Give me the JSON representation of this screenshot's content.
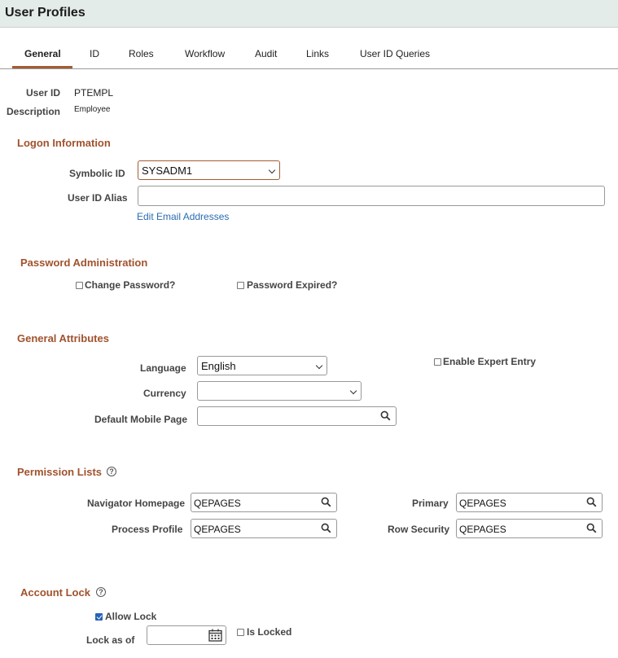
{
  "header": {
    "title": "User Profiles"
  },
  "tabs": [
    {
      "label": "General",
      "active": true
    },
    {
      "label": "ID"
    },
    {
      "label": "Roles"
    },
    {
      "label": "Workflow"
    },
    {
      "label": "Audit"
    },
    {
      "label": "Links"
    },
    {
      "label": "User ID Queries"
    }
  ],
  "summary": {
    "user_id_label": "User ID",
    "user_id": "PTEMPL",
    "description_label": "Description",
    "description": "Employee"
  },
  "logon": {
    "title": "Logon Information",
    "symbolic_id_label": "Symbolic ID",
    "symbolic_id": "SYSADM1",
    "alias_label": "User ID Alias",
    "alias": "",
    "edit_email_link": "Edit Email Addresses"
  },
  "password": {
    "title": "Password Administration",
    "change_label": "Change Password?",
    "change_checked": false,
    "expired_label": "Password Expired?",
    "expired_checked": false
  },
  "attributes": {
    "title": "General Attributes",
    "language_label": "Language",
    "language": "English",
    "currency_label": "Currency",
    "currency": "",
    "mobile_label": "Default Mobile Page",
    "mobile": "",
    "expert_label": "Enable Expert Entry",
    "expert_checked": false
  },
  "permissions": {
    "title": "Permission Lists",
    "navigator_label": "Navigator Homepage",
    "navigator": "QEPAGES",
    "process_label": "Process Profile",
    "process": "QEPAGES",
    "primary_label": "Primary",
    "primary": "QEPAGES",
    "row_security_label": "Row Security",
    "row_security": "QEPAGES"
  },
  "account_lock": {
    "title": "Account Lock",
    "allow_lock_label": "Allow Lock",
    "allow_lock_checked": true,
    "lock_as_of_label": "Lock as of",
    "lock_as_of": "",
    "is_locked_label": "Is Locked",
    "is_locked_checked": false
  },
  "colors": {
    "accent": "#a0522d",
    "link": "#2a6bb0",
    "header_bg": "#e3ece9",
    "checkbox": "#2663b8"
  },
  "icons": [
    "search-icon",
    "chevron-down-icon",
    "help-icon",
    "calendar-icon"
  ]
}
